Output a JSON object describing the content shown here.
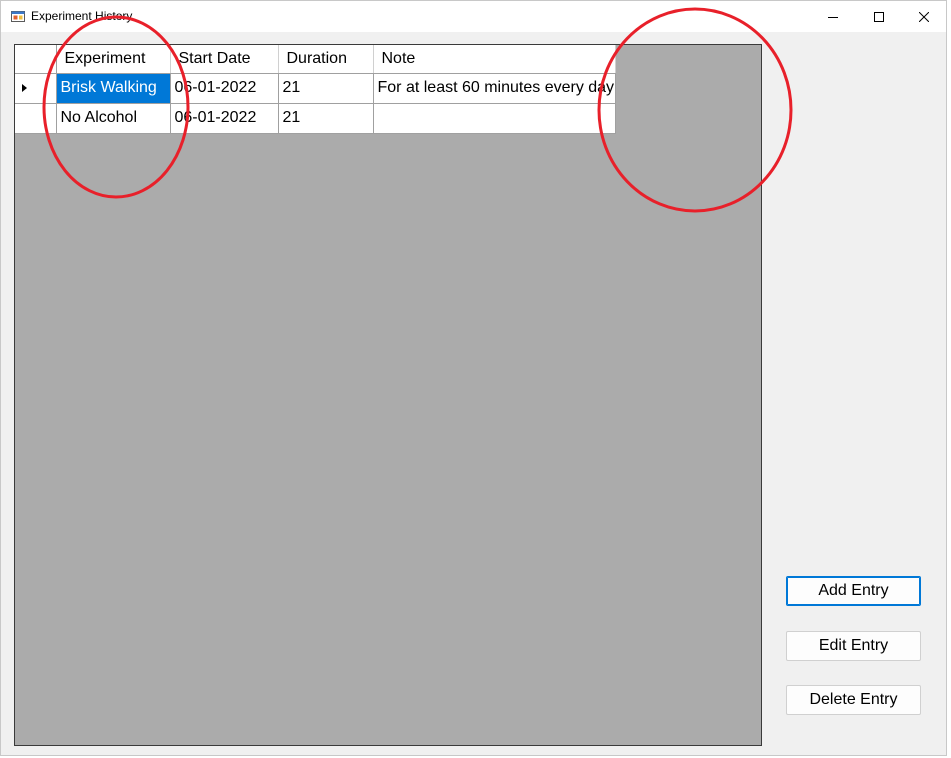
{
  "window": {
    "title": "Experiment History",
    "controls": {
      "minimize": "minimize-icon",
      "maximize": "maximize-icon",
      "close": "close-icon"
    }
  },
  "grid": {
    "columns": [
      "Experiment",
      "Start Date",
      "Duration",
      "Note"
    ],
    "rows": [
      {
        "experiment": "Brisk Walking",
        "start_date": "06-01-2022",
        "duration": "21",
        "note": "For at least 60 minutes every day",
        "current": true
      },
      {
        "experiment": "No Alcohol",
        "start_date": "06-01-2022",
        "duration": "21",
        "note": "",
        "current": false
      }
    ],
    "selected_cell": "rows.0.experiment",
    "colors": {
      "background": "#ababab",
      "selection": "#0078d7"
    }
  },
  "buttons": {
    "add": "Add Entry",
    "edit": "Edit Entry",
    "delete": "Delete Entry"
  },
  "annotations": {
    "color": "#e8202a",
    "shape": "red-circle"
  }
}
